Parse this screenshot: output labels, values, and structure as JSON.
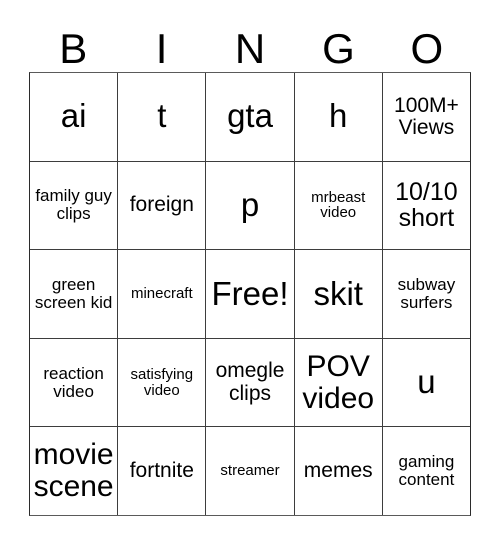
{
  "card": {
    "title": "BINGO",
    "free_space_label": "Free!",
    "header_letters": [
      "B",
      "I",
      "N",
      "G",
      "O"
    ],
    "columns": 5,
    "rows": 5,
    "border_color": "#3d3d3d",
    "background_color": "#ffffff",
    "text_color": "#000000"
  },
  "grid": [
    [
      {
        "text": "ai",
        "size": "xl"
      },
      {
        "text": "t",
        "size": "xl"
      },
      {
        "text": "gta",
        "size": "xl"
      },
      {
        "text": "h",
        "size": "xl"
      },
      {
        "text": "100M+ Views",
        "size": "sm"
      }
    ],
    [
      {
        "text": "family guy clips",
        "size": "xs"
      },
      {
        "text": "foreign",
        "size": "sm"
      },
      {
        "text": "p",
        "size": "xl"
      },
      {
        "text": "mrbeast video",
        "size": "xxs"
      },
      {
        "text": "10/10 short",
        "size": "md"
      }
    ],
    [
      {
        "text": "green screen kid",
        "size": "xs"
      },
      {
        "text": "minecraft",
        "size": "xxs"
      },
      {
        "text": "Free!",
        "size": "xl"
      },
      {
        "text": "skit",
        "size": "xl"
      },
      {
        "text": "subway surfers",
        "size": "xs"
      }
    ],
    [
      {
        "text": "reaction video",
        "size": "xs"
      },
      {
        "text": "satisfying video",
        "size": "xxs"
      },
      {
        "text": "omegle clips",
        "size": "sm"
      },
      {
        "text": "POV video",
        "size": "lg"
      },
      {
        "text": "u",
        "size": "xl"
      }
    ],
    [
      {
        "text": "movie scene",
        "size": "lg"
      },
      {
        "text": "fortnite",
        "size": "sm"
      },
      {
        "text": "streamer",
        "size": "xxs"
      },
      {
        "text": "memes",
        "size": "sm"
      },
      {
        "text": "gaming content",
        "size": "xs"
      }
    ]
  ]
}
